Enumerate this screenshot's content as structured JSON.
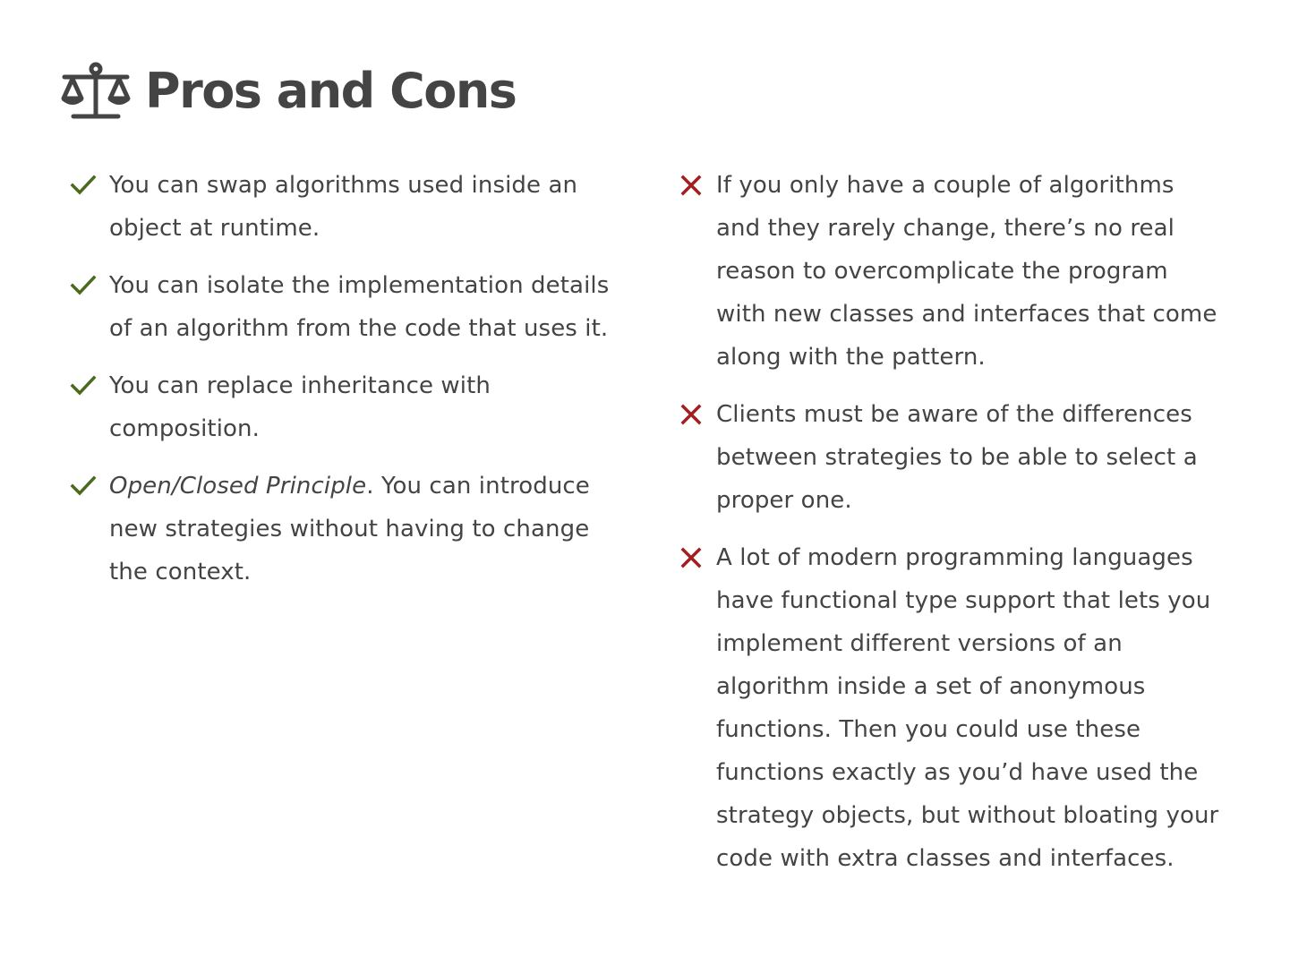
{
  "section": {
    "title": "Pros and Cons",
    "icon": "balance-scale-icon"
  },
  "colors": {
    "text": "#444444",
    "pro_check": "#4a6b1d",
    "con_cross": "#a31f1f"
  },
  "pros": {
    "icon": "check-icon",
    "items": [
      {
        "text": "You can swap algorithms used inside an object at runtime."
      },
      {
        "text": "You can isolate the implementation details of an algorithm from the code that uses it."
      },
      {
        "text": "You can replace inheritance with composition."
      },
      {
        "emphasis": "Open/Closed Principle",
        "text": ". You can introduce new strategies without having to change the context."
      }
    ]
  },
  "cons": {
    "icon": "cross-icon",
    "items": [
      {
        "text": "If you only have a couple of algorithms and they rarely change, there’s no real reason to overcomplicate the program with new classes and interfaces that come along with the pattern."
      },
      {
        "text": "Clients must be aware of the differences between strategies to be able to select a proper one."
      },
      {
        "text": "A lot of modern programming languages have functional type support that lets you implement different versions of an algorithm inside a set of anonymous functions. Then you could use these functions exactly as you’d have used the strategy objects, but without bloating your code with extra classes and interfaces."
      }
    ]
  }
}
